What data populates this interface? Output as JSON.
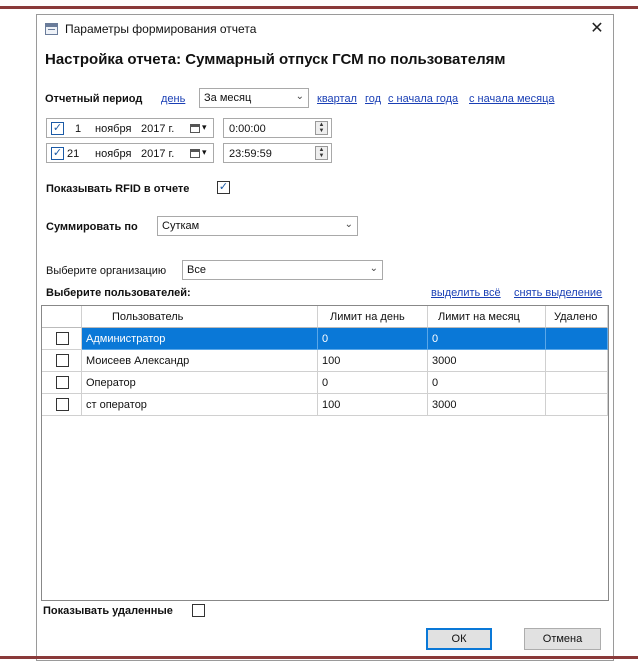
{
  "window": {
    "title": "Параметры формирования отчета",
    "heading": "Настройка отчета: Суммарный отпуск ГСМ по пользователям"
  },
  "period": {
    "label": "Отчетный период",
    "link_day": "день",
    "selected": "За месяц",
    "link_quarter": "квартал",
    "link_year": "год",
    "link_from_year_start": "с начала года",
    "link_from_month_start": "с начала месяца"
  },
  "start": {
    "checked": true,
    "day": "1",
    "month": "ноября",
    "year": "2017 г.",
    "time": "0:00:00"
  },
  "end": {
    "checked": true,
    "day": "21",
    "month": "ноября",
    "year": "2017 г.",
    "time": "23:59:59"
  },
  "rfid": {
    "label": "Показывать RFID в отчете",
    "checked": true
  },
  "summarize": {
    "label": "Суммировать по",
    "selected": "Суткам"
  },
  "organization": {
    "label": "Выберите организацию",
    "selected": "Все"
  },
  "users": {
    "label": "Выберите пользователей:",
    "select_all": "выделить всё",
    "clear_selection": "снять выделение",
    "columns": [
      "Пользователь",
      "Лимит на день",
      "Лимит на месяц",
      "Удалено"
    ],
    "rows": [
      {
        "name": "Администратор",
        "day_limit": "0",
        "month_limit": "0",
        "deleted": "",
        "checked": false,
        "selected": true
      },
      {
        "name": "Моисеев Александр",
        "day_limit": "100",
        "month_limit": "3000",
        "deleted": "",
        "checked": false,
        "selected": false
      },
      {
        "name": "Оператор",
        "day_limit": "0",
        "month_limit": "0",
        "deleted": "",
        "checked": false,
        "selected": false
      },
      {
        "name": "ст оператор",
        "day_limit": "100",
        "month_limit": "3000",
        "deleted": "",
        "checked": false,
        "selected": false
      }
    ]
  },
  "show_deleted": {
    "label": "Показывать удаленные",
    "checked": false
  },
  "buttons": {
    "ok": "ОК",
    "cancel": "Отмена"
  },
  "colors": {
    "selection": "#0a78d7",
    "link": "#1a3fb5",
    "accent_line": "#8a3a3a"
  }
}
